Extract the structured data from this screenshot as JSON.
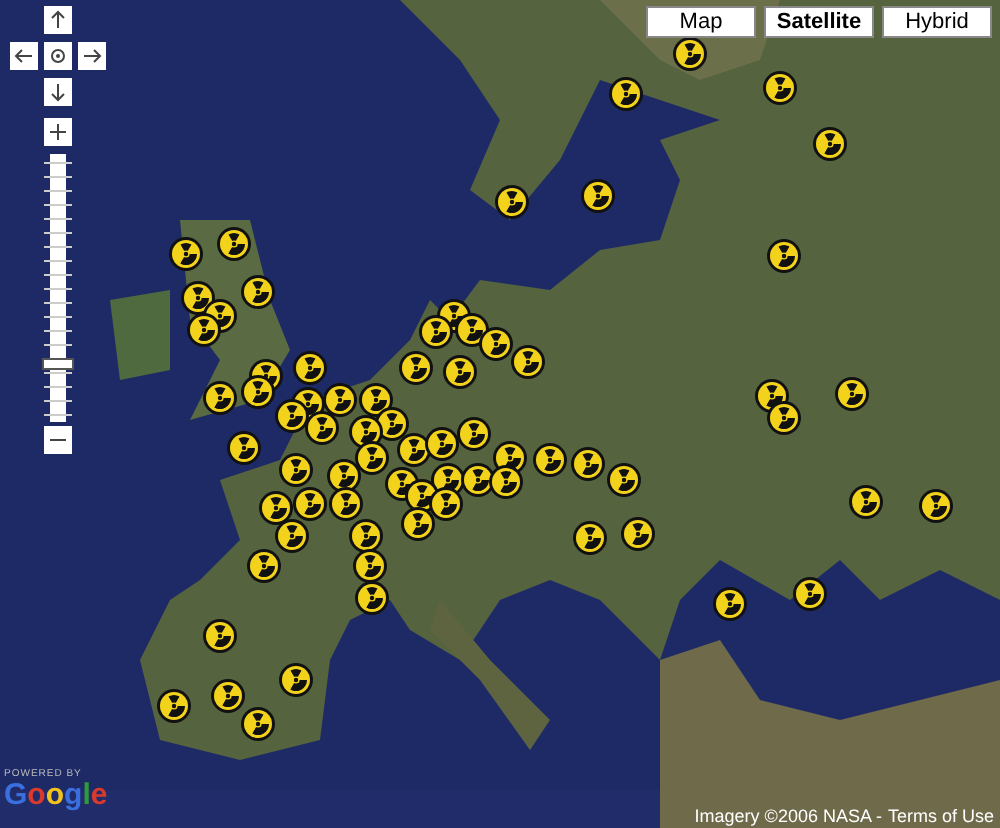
{
  "map_types": [
    {
      "label": "Map",
      "selected": false
    },
    {
      "label": "Satellite",
      "selected": true
    },
    {
      "label": "Hybrid",
      "selected": false
    }
  ],
  "zoom_slider": {
    "level": 0.2
  },
  "logo": {
    "caption": "POWERED BY",
    "name": "Google"
  },
  "attribution": {
    "text": "Imagery ©2006 NASA -",
    "link": "Terms of Use"
  }
}
